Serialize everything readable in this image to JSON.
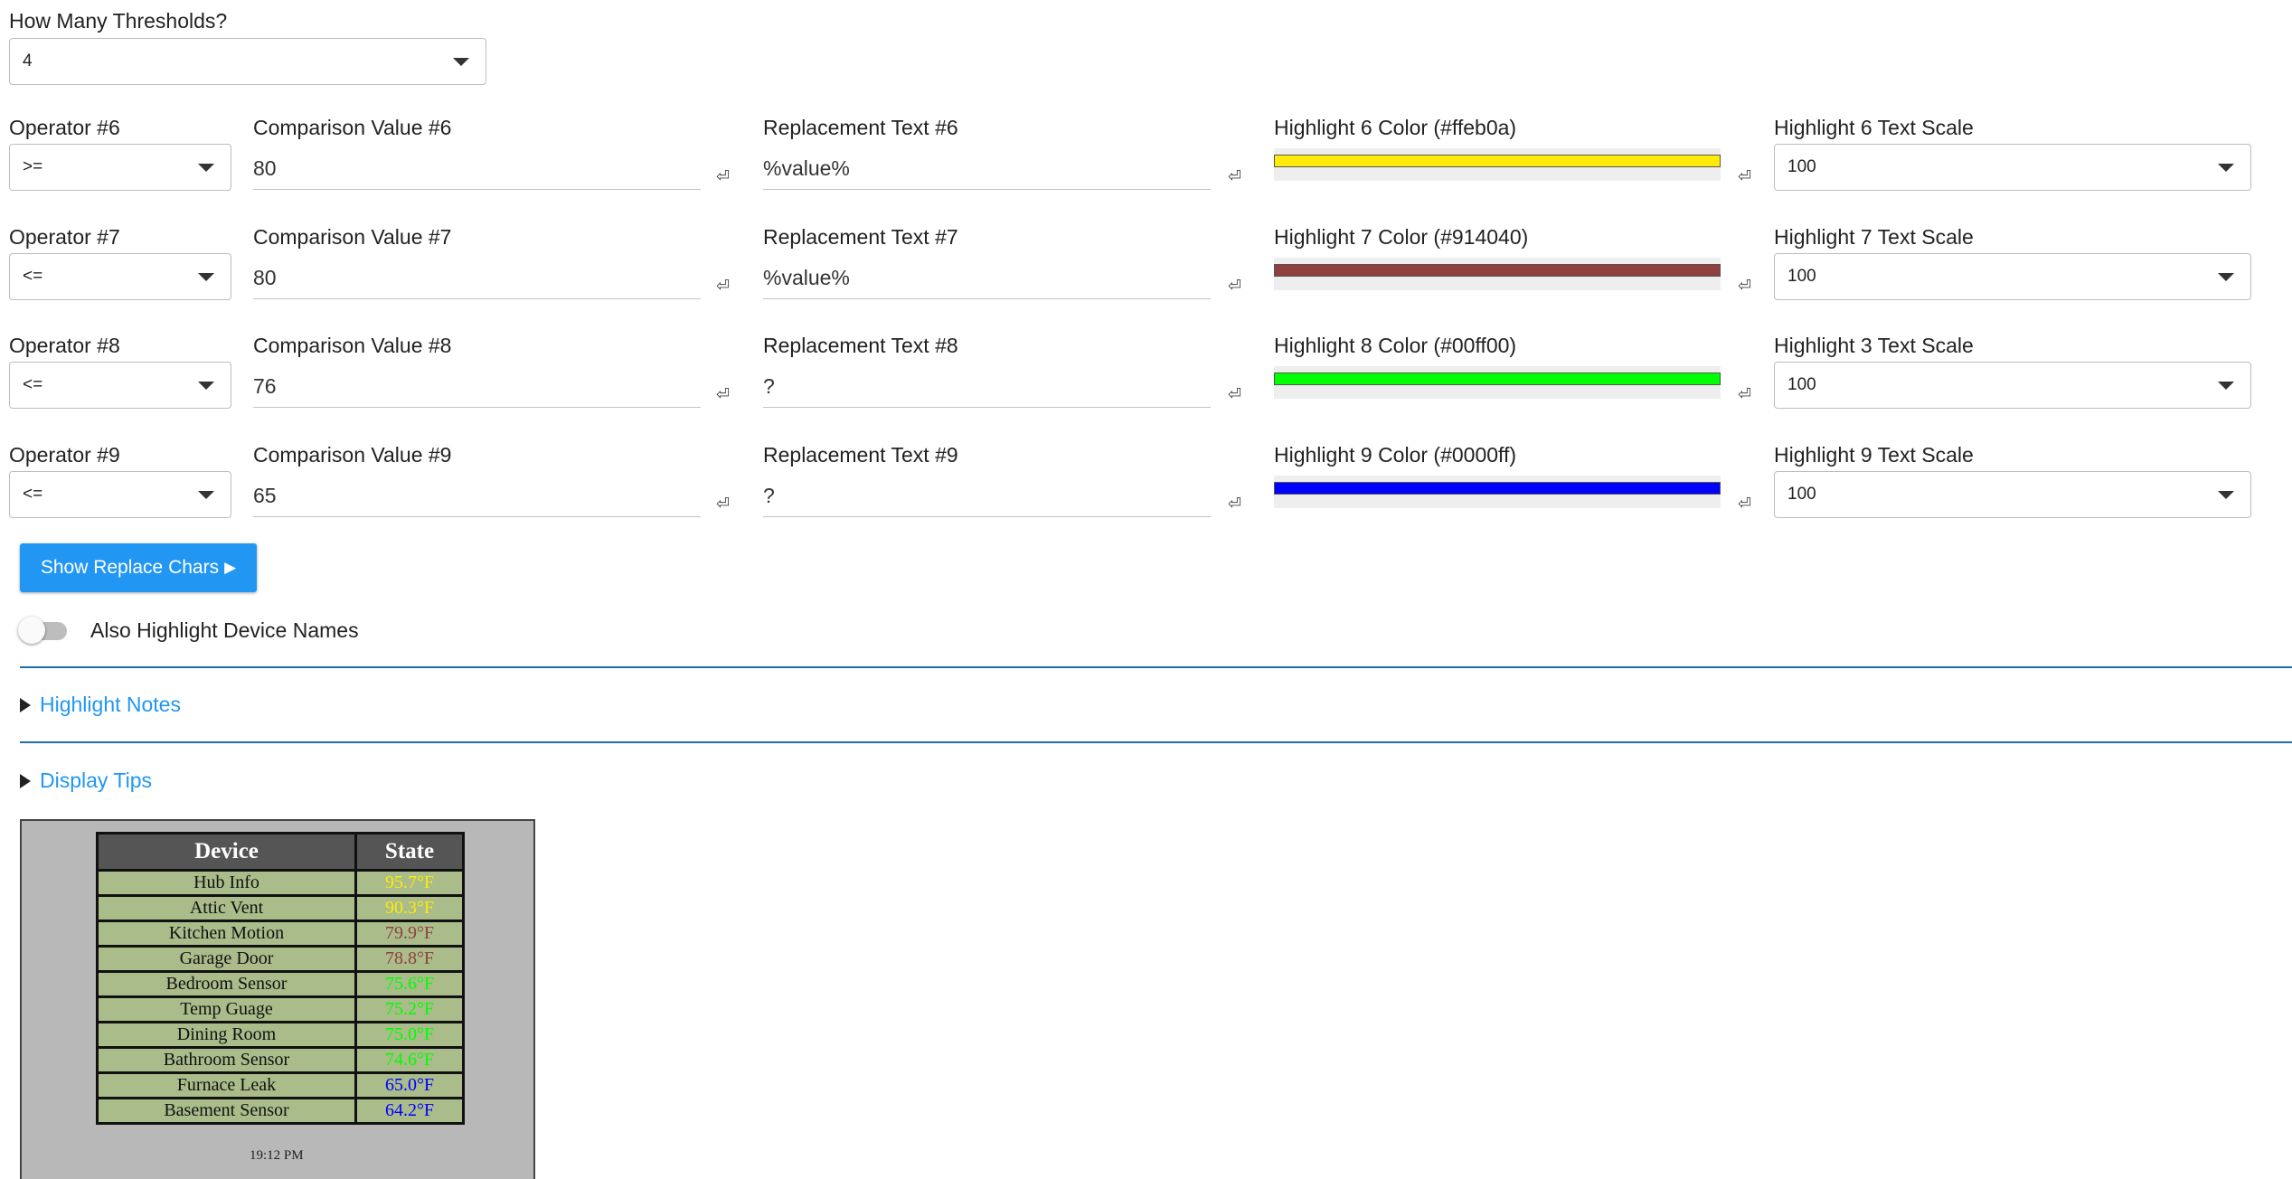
{
  "thresholds": {
    "label": "How Many Thresholds?",
    "value": "4"
  },
  "rows": [
    {
      "operator_label": "Operator #6",
      "operator_value": ">=",
      "comparison_label": "Comparison Value #6",
      "comparison_value": "80",
      "replacement_label": "Replacement Text #6",
      "replacement_value": "%value%",
      "color_label": "Highlight 6 Color (#ffeb0a)",
      "color": "#ffeb0a",
      "scale_label": "Highlight 6 Text Scale",
      "scale_value": "100"
    },
    {
      "operator_label": "Operator #7",
      "operator_value": "<=",
      "comparison_label": "Comparison Value #7",
      "comparison_value": "80",
      "replacement_label": "Replacement Text #7",
      "replacement_value": "%value%",
      "color_label": "Highlight 7 Color (#914040)",
      "color": "#914040",
      "scale_label": "Highlight 7 Text Scale",
      "scale_value": "100"
    },
    {
      "operator_label": "Operator #8",
      "operator_value": "<=",
      "comparison_label": "Comparison Value #8",
      "comparison_value": "76",
      "replacement_label": "Replacement Text #8",
      "replacement_value": "?",
      "color_label": "Highlight 8 Color (#00ff00)",
      "color": "#00ff00",
      "scale_label": "Highlight 3 Text Scale",
      "scale_value": "100"
    },
    {
      "operator_label": "Operator #9",
      "operator_value": "<=",
      "comparison_label": "Comparison Value #9",
      "comparison_value": "65",
      "replacement_label": "Replacement Text #9",
      "replacement_value": "?",
      "color_label": "Highlight 9 Color (#0000ff)",
      "color": "#0000ff",
      "scale_label": "Highlight 9 Text Scale",
      "scale_value": "100"
    }
  ],
  "enter_icon_glyph": "⏎",
  "replace_button": {
    "label": "Show Replace Chars",
    "icon": "play-icon",
    "glyph": "▶"
  },
  "toggle": {
    "label": "Also Highlight Device Names",
    "on": false
  },
  "sections": {
    "notes": "Highlight Notes",
    "tips": "Display Tips"
  },
  "accent_color": "#2196f3",
  "preview": {
    "headers": [
      "Device",
      "State"
    ],
    "rows": [
      {
        "device": "Hub Info",
        "state": "95.7°F",
        "color": "#ffeb0a"
      },
      {
        "device": "Attic Vent",
        "state": "90.3°F",
        "color": "#ffeb0a"
      },
      {
        "device": "Kitchen Motion",
        "state": "79.9°F",
        "color": "#914040"
      },
      {
        "device": "Garage Door",
        "state": "78.8°F",
        "color": "#914040"
      },
      {
        "device": "Bedroom Sensor",
        "state": "75.6°F",
        "color": "#00ff00"
      },
      {
        "device": "Temp Guage",
        "state": "75.2°F",
        "color": "#00ff00"
      },
      {
        "device": "Dining Room",
        "state": "75.0°F",
        "color": "#00ff00"
      },
      {
        "device": "Bathroom Sensor",
        "state": "74.6°F",
        "color": "#00ff00"
      },
      {
        "device": "Furnace Leak",
        "state": "65.0°F",
        "color": "#0000ff"
      },
      {
        "device": "Basement Sensor",
        "state": "64.2°F",
        "color": "#0000ff"
      }
    ],
    "time": "19:12 PM"
  }
}
